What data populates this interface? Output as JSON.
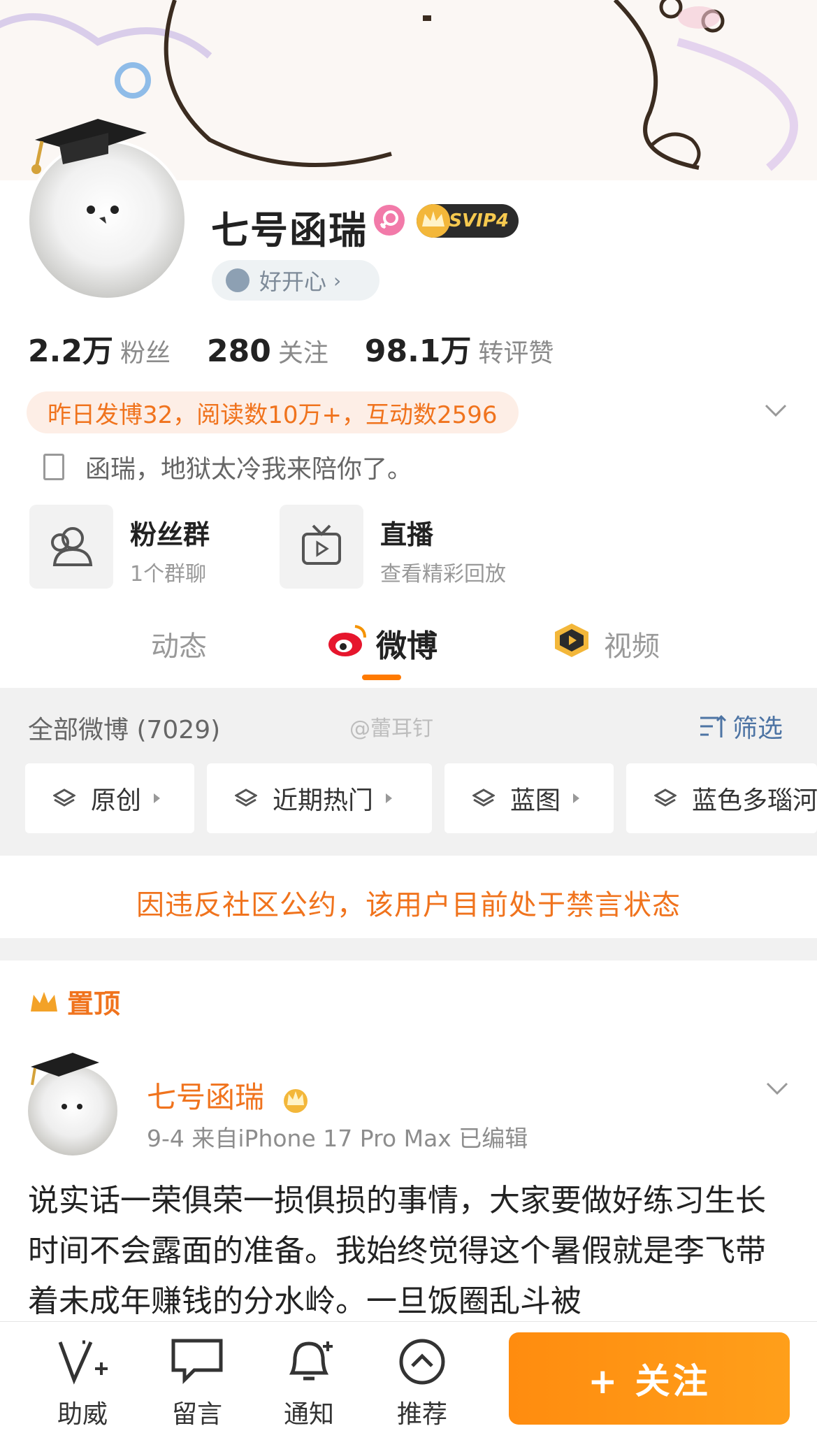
{
  "profile": {
    "name": "七号函瑞",
    "badge": "SVIP4",
    "mood": "好开心",
    "mood_arrow": "›"
  },
  "stats": [
    {
      "num": "2.2万",
      "label": "粉丝"
    },
    {
      "num": "280",
      "label": "关注"
    },
    {
      "num": "98.1万",
      "label": "转评赞"
    }
  ],
  "activity_pill": "昨日发博32，阅读数10万+，互动数2596",
  "bio": "函瑞，地狱太冷我来陪你了。",
  "tiles": [
    {
      "title": "粉丝群",
      "sub": "1个群聊",
      "icon": "people-icon"
    },
    {
      "title": "直播",
      "sub": "查看精彩回放",
      "icon": "tv-icon"
    }
  ],
  "tabs": [
    {
      "label": "动态",
      "active": false
    },
    {
      "label": "微博",
      "active": true
    },
    {
      "label": "视频",
      "active": false
    }
  ],
  "weibo_header": {
    "all": "全部微博 (7029)",
    "watermark": "@蕾耳钉",
    "filter": "筛选"
  },
  "chips": [
    "原创",
    "近期热门",
    "蓝图",
    "蓝色多瑙河"
  ],
  "ban_notice": "因违反社区公约，该用户目前处于禁言状态",
  "pinned_label": "置顶",
  "post": {
    "author": "七号函瑞",
    "meta": "9-4  来自iPhone 17 Pro Max  已编辑",
    "text": "说实话一荣俱荣一损俱损的事情，大家要做好练习生长时间不会露面的准备。我始终觉得这个暑假就是李飞带着未成年赚钱的分水岭。一旦饭圈乱斗被"
  },
  "bottom_bar": {
    "items": [
      "助威",
      "留言",
      "通知",
      "推荐"
    ],
    "follow": "+ 关注"
  },
  "colors": {
    "accent": "#f0731d",
    "follow_button": "#ff8c0f",
    "filter_link": "#4d74a4"
  }
}
